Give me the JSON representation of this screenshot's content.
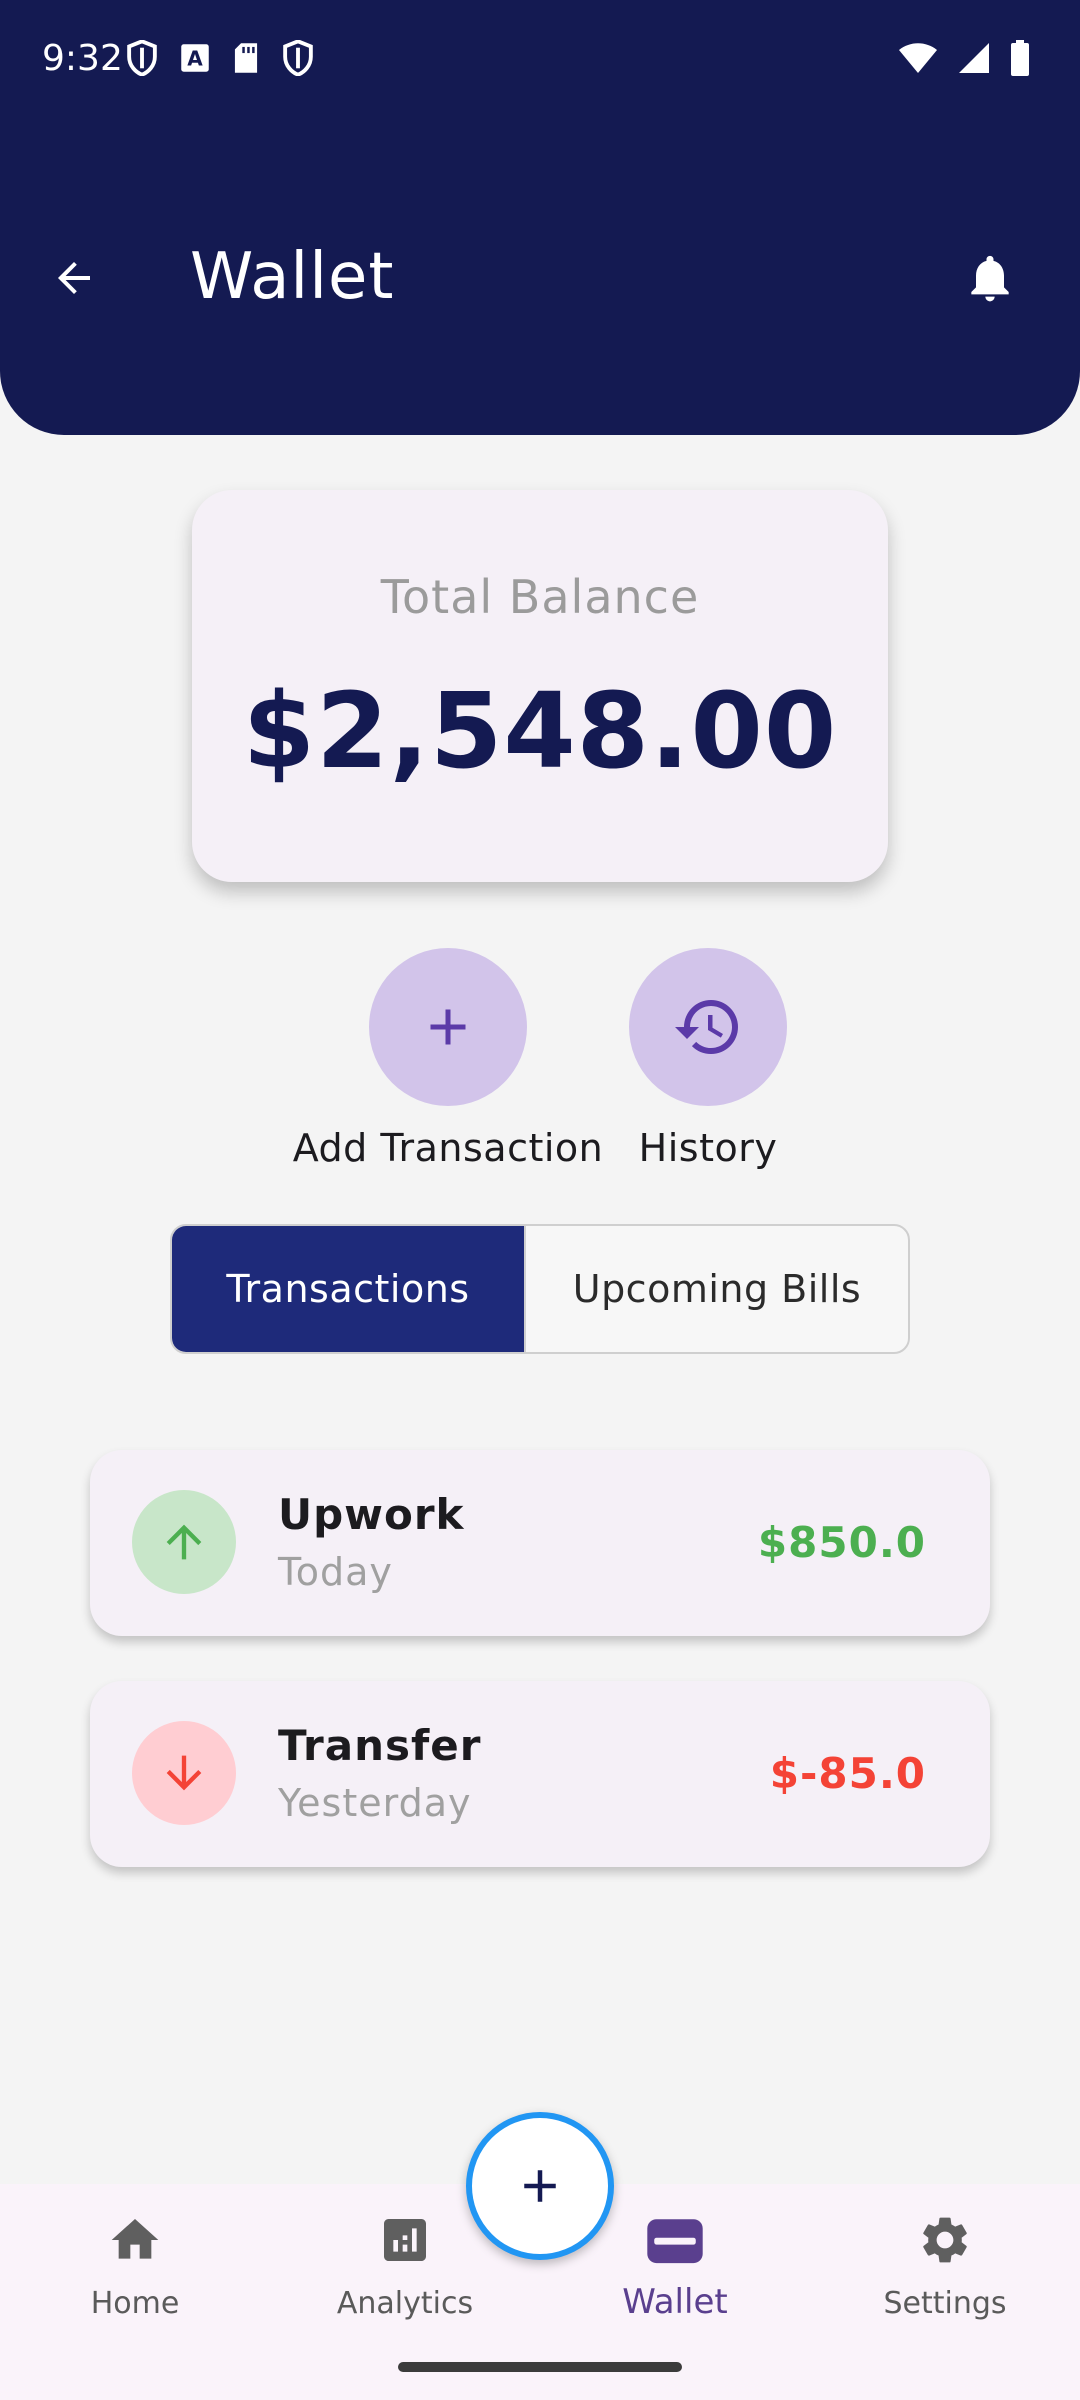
{
  "status_bar": {
    "time": "9:32",
    "left_icons": [
      "shield-icon",
      "text-a-icon",
      "sd-card-icon",
      "shield-icon"
    ],
    "right_icons": [
      "wifi-icon",
      "cell-signal-icon",
      "battery-icon"
    ]
  },
  "header": {
    "title": "Wallet",
    "back_icon": "arrow-back-icon",
    "bell_icon": "bell-icon",
    "background_color": "#141a52"
  },
  "balance": {
    "label": "Total Balance",
    "amount": "$2,548.00"
  },
  "actions": [
    {
      "label": "Add Transaction",
      "icon": "plus-icon"
    },
    {
      "label": "History",
      "icon": "history-icon"
    }
  ],
  "tabs": [
    {
      "label": "Transactions",
      "active": true
    },
    {
      "label": "Upcoming Bills",
      "active": false
    }
  ],
  "transactions": [
    {
      "name": "Upwork",
      "date": "Today",
      "amount": "$850.0",
      "direction": "in",
      "icon": "arrow-up-icon",
      "amount_color": "#4caf50",
      "icon_bg": "#c8e6c9"
    },
    {
      "name": "Transfer",
      "date": "Yesterday",
      "amount": "$-85.0",
      "direction": "out",
      "icon": "arrow-down-icon",
      "amount_color": "#f44336",
      "icon_bg": "#ffcdd2"
    }
  ],
  "fab": {
    "icon": "plus-icon",
    "border_color": "#2196f3"
  },
  "bottom_nav": [
    {
      "label": "Home",
      "icon": "home-icon",
      "active": false
    },
    {
      "label": "Analytics",
      "icon": "analytics-icon",
      "active": false
    },
    {
      "label": "Wallet",
      "icon": "wallet-icon",
      "active": true
    },
    {
      "label": "Settings",
      "icon": "gear-icon",
      "active": false
    }
  ],
  "colors": {
    "accent": "#5a3f8e",
    "tab_active": "#1e2a7a",
    "action_circle": "#d2c4ea"
  }
}
